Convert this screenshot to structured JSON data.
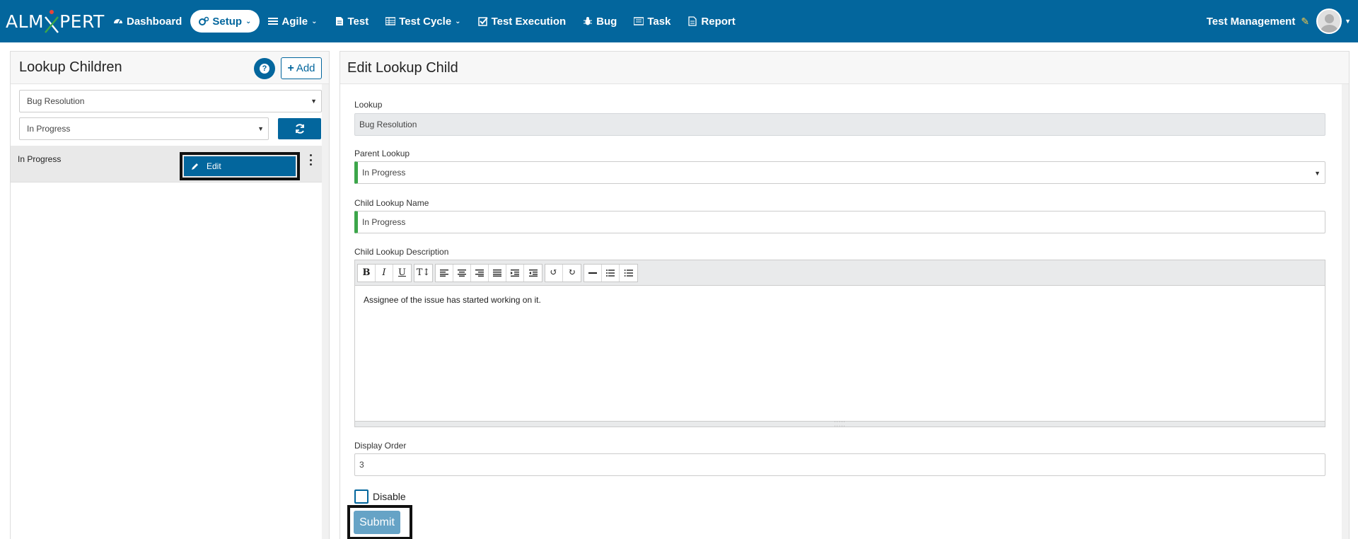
{
  "navbar": {
    "logo": {
      "part1": "ALM",
      "part2": "PERT"
    },
    "items": [
      {
        "label": "Dashboard",
        "icon": "tachometer-icon"
      },
      {
        "label": "Setup",
        "icon": "cogs-icon",
        "active": true,
        "has_caret": true
      },
      {
        "label": "Agile",
        "icon": "list-icon",
        "has_caret": true
      },
      {
        "label": "Test",
        "icon": "file-icon"
      },
      {
        "label": "Test Cycle",
        "icon": "table-icon",
        "has_caret": true
      },
      {
        "label": "Test Execution",
        "icon": "check-square-icon"
      },
      {
        "label": "Bug",
        "icon": "bug-icon"
      },
      {
        "label": "Task",
        "icon": "tasks-icon"
      },
      {
        "label": "Report",
        "icon": "file-text-icon"
      }
    ],
    "project": "Test Management",
    "accent": "#03669d"
  },
  "left": {
    "title": "Lookup Children",
    "add_label": "Add",
    "lookup_select": "Bug Resolution",
    "parent_select": "In Progress",
    "rows": [
      {
        "label": "In Progress"
      }
    ],
    "edit_label": "Edit"
  },
  "right": {
    "title": "Edit Lookup Child",
    "lookup_label": "Lookup",
    "lookup_value": "Bug Resolution",
    "parent_label": "Parent Lookup",
    "parent_value": "In Progress",
    "child_name_label": "Child Lookup Name",
    "child_name_value": "In Progress",
    "description_label": "Child Lookup Description",
    "description_value": "Assignee of the issue has started working on it.",
    "display_order_label": "Display Order",
    "display_order_value": "3",
    "disable_label": "Disable",
    "submit_label": "Submit"
  }
}
